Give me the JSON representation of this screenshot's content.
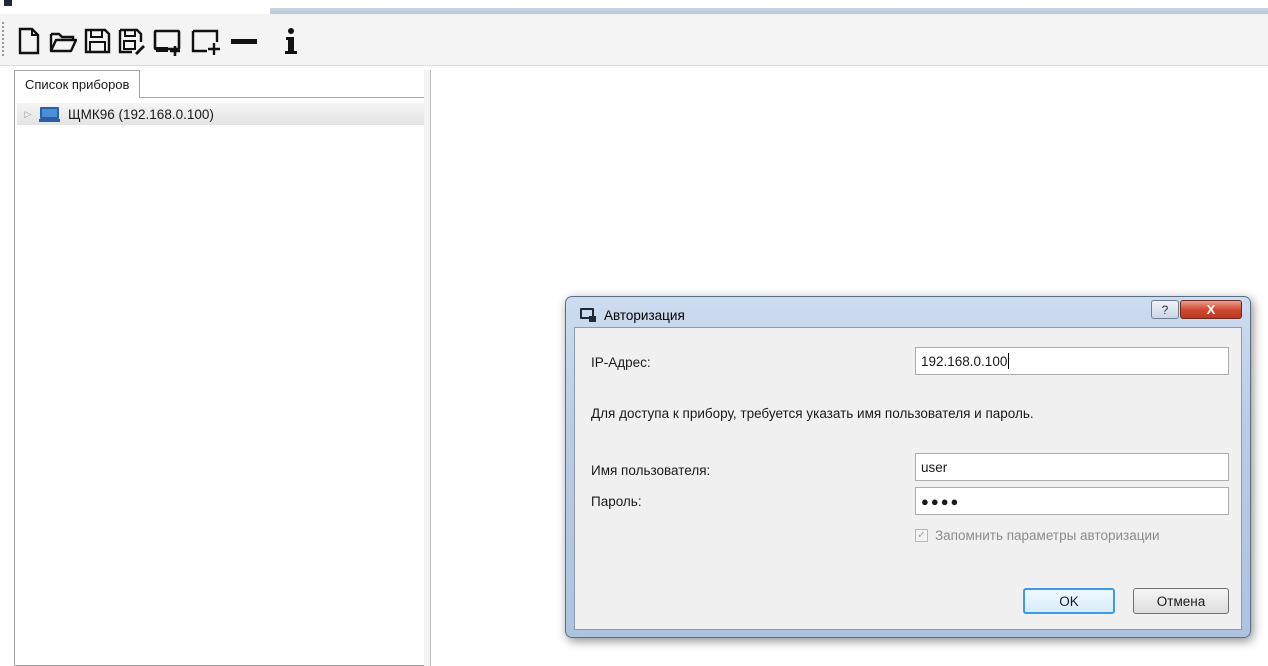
{
  "toolbar": {
    "buttons": [
      {
        "name": "new-file",
        "icon": "new-document-icon"
      },
      {
        "name": "open-file",
        "icon": "open-folder-icon"
      },
      {
        "name": "save-file",
        "icon": "save-icon"
      },
      {
        "name": "save-as",
        "icon": "save-as-icon"
      },
      {
        "name": "add-device",
        "icon": "add-device-icon"
      },
      {
        "name": "add-group",
        "icon": "add-group-icon"
      },
      {
        "name": "remove",
        "icon": "minus-icon"
      },
      {
        "name": "info",
        "icon": "info-icon"
      }
    ]
  },
  "left_panel": {
    "tab_label": "Список приборов",
    "tree_items": [
      {
        "label": "ЩМК96 (192.168.0.100)",
        "icon": "device-monitor-icon",
        "expanded": false
      }
    ]
  },
  "dialog": {
    "title": "Авторизация",
    "help_label": "?",
    "close_label": "X",
    "ip_label": "IP-Адрес:",
    "ip_value": "192.168.0.100",
    "info_text": "Для доступа к прибору, требуется указать имя пользователя и пароль.",
    "username_label": "Имя пользователя:",
    "username_value": "user",
    "password_label": "Пароль:",
    "password_mask": "●●●●",
    "remember_label": "Запомнить параметры авторизации",
    "remember_checked": true,
    "ok_label": "OK",
    "cancel_label": "Отмена"
  },
  "colors": {
    "dialog_frame": "#b9cce4",
    "close_button": "#c0361f",
    "device_icon": "#2a5fa8",
    "ok_focus": "#3c9be8"
  }
}
